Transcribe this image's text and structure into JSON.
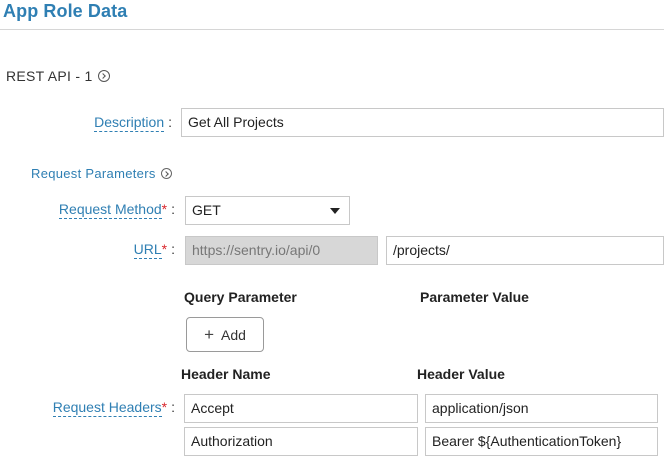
{
  "header": {
    "title": "App Role Data"
  },
  "api_section": {
    "title": "REST API - 1"
  },
  "description": {
    "label": "Description",
    "colon": ":",
    "value": "Get All Projects"
  },
  "request_params": {
    "title": "Request Parameters"
  },
  "request_method": {
    "label": "Request Method",
    "required": "*",
    "colon": ":",
    "value": "GET"
  },
  "url": {
    "label": "URL",
    "required": "*",
    "colon": ":",
    "base": "https://sentry.io/api/0",
    "path": "/projects/"
  },
  "query": {
    "col_name": "Query Parameter",
    "col_value": "Parameter Value",
    "add_label": "Add"
  },
  "headers": {
    "label": "Request Headers",
    "required": "*",
    "colon": ":",
    "col_name": "Header Name",
    "col_value": "Header Value",
    "rows": [
      {
        "name": "Accept",
        "value": "application/json"
      },
      {
        "name": "Authorization",
        "value": "Bearer ${AuthenticationToken}"
      }
    ]
  },
  "colors": {
    "accent": "#2f7fb3",
    "required": "#d9262c",
    "disabled_bg": "#d7d7d7"
  }
}
